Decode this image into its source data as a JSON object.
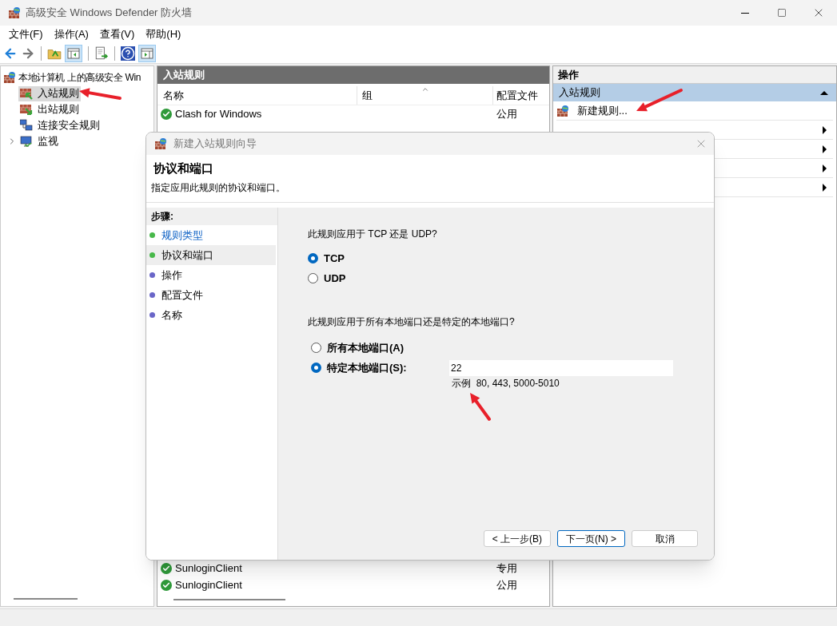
{
  "window": {
    "title": "高级安全 Windows Defender 防火墙"
  },
  "menu": [
    "文件(F)",
    "操作(A)",
    "查看(V)",
    "帮助(H)"
  ],
  "tree": {
    "label": "本地计算机 上的高级安全 Win",
    "children": [
      {
        "label": "入站规则",
        "kind": "inbound",
        "selected": true
      },
      {
        "label": "出站规则",
        "kind": "outbound",
        "selected": false
      },
      {
        "label": "连接安全规则",
        "kind": "connection",
        "selected": false
      },
      {
        "label": "监视",
        "kind": "monitor",
        "selected": false,
        "expanded": false
      }
    ]
  },
  "rules_panel": {
    "title": "入站规则",
    "columns": [
      "名称",
      "组",
      "配置文件"
    ],
    "rows_top": [
      {
        "name": "Clash for Windows",
        "profile": "公用",
        "enabled": true
      }
    ],
    "rows_bottom": [
      {
        "name": "SunloginClient",
        "profile": "专用",
        "enabled": true
      },
      {
        "name": "SunloginClient",
        "profile": "公用",
        "enabled": true
      }
    ]
  },
  "actions_panel": {
    "title": "操作",
    "section": {
      "title": "入站规则",
      "expanded": true
    },
    "items": [
      {
        "label": "新建规则...",
        "submenu": false
      },
      {
        "submenu": true
      },
      {
        "submenu": true
      },
      {
        "submenu": true
      },
      {
        "submenu": true
      }
    ]
  },
  "dialog": {
    "title": "新建入站规则向导",
    "heading": "协议和端口",
    "subtitle": "指定应用此规则的协议和端口。",
    "steps_title": "步骤:",
    "steps": [
      {
        "label": "规则类型",
        "completed": true,
        "selected": false
      },
      {
        "label": "协议和端口",
        "completed": true,
        "selected": true
      },
      {
        "label": "操作",
        "completed": false,
        "selected": false
      },
      {
        "label": "配置文件",
        "completed": false,
        "selected": false
      },
      {
        "label": "名称",
        "completed": false,
        "selected": false
      }
    ],
    "protocol_question": "此规则应用于 TCP 还是 UDP?",
    "protocols": [
      {
        "label": "TCP",
        "selected": true
      },
      {
        "label": "UDP",
        "selected": false
      }
    ],
    "port_question": "此规则应用于所有本地端口还是特定的本地端口?",
    "port_options": [
      {
        "label": "所有本地端口(A)",
        "selected": false
      },
      {
        "label": "特定本地端口(S):",
        "selected": true
      }
    ],
    "port_value": "22",
    "port_hint": "示例  80, 443, 5000-5010",
    "buttons": [
      {
        "label": "< 上一步(B)",
        "default": false
      },
      {
        "label": "下一页(N) >",
        "default": true
      },
      {
        "label": "取消",
        "default": false
      }
    ]
  }
}
